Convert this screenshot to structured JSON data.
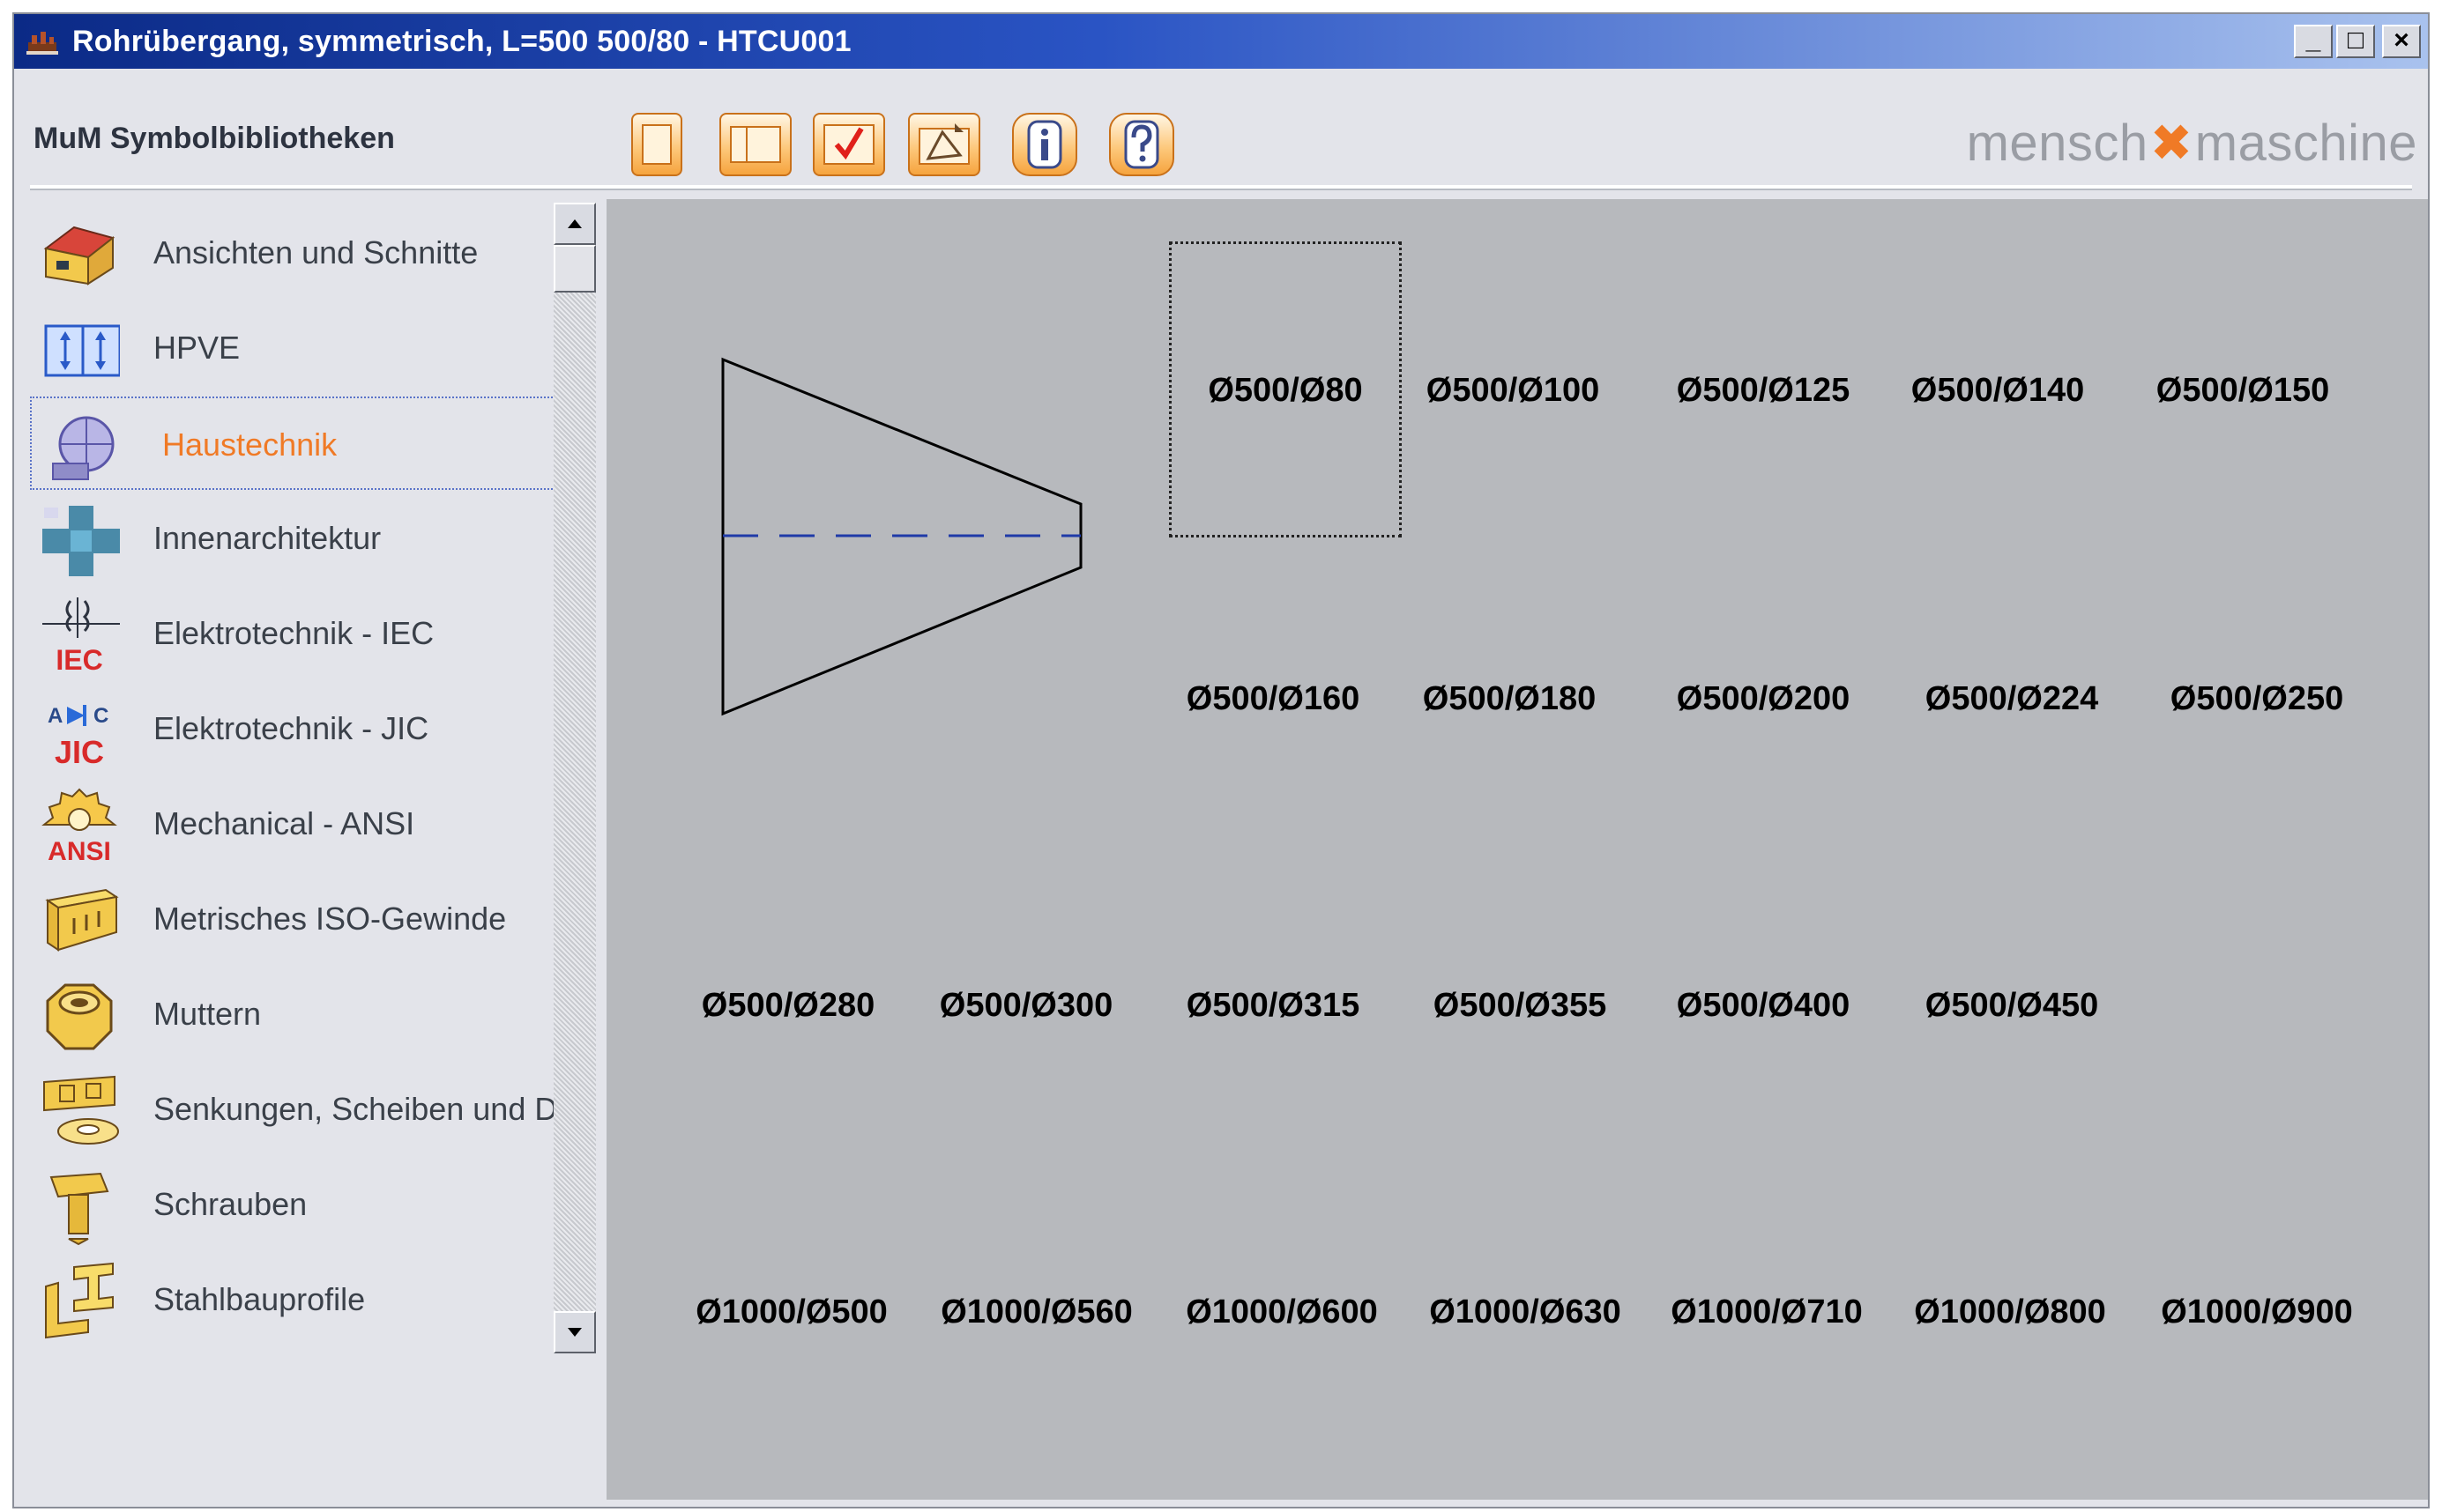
{
  "window": {
    "title": "Rohrübergang, symmetrisch, L=500 500/80 - HTCU001",
    "controls": {
      "minimize": "_",
      "maximize": "□",
      "close": "×"
    }
  },
  "toolbar": {
    "library_title": "MuM Symbolbibliotheken",
    "brand_left": "mensch",
    "brand_right": "maschine"
  },
  "sidebar": {
    "items": [
      {
        "label": "Ansichten und Schnitte",
        "icon": "house-icon"
      },
      {
        "label": "HPVE",
        "icon": "arrows-icon"
      },
      {
        "label": "Haustechnik",
        "icon": "pump-icon",
        "selected": true
      },
      {
        "label": "Innenarchitektur",
        "icon": "furniture-icon"
      },
      {
        "label": "Elektrotechnik - IEC",
        "icon": "iec-icon",
        "badge": "IEC"
      },
      {
        "label": "Elektrotechnik - JIC",
        "icon": "jic-icon",
        "badge": "JIC"
      },
      {
        "label": "Mechanical - ANSI",
        "icon": "gear-icon",
        "badge": "ANSI"
      },
      {
        "label": "Metrisches ISO-Gewinde",
        "icon": "thread-icon"
      },
      {
        "label": "Muttern",
        "icon": "nut-icon"
      },
      {
        "label": "Senkungen, Scheiben und Du",
        "icon": "washer-icon"
      },
      {
        "label": "Schrauben",
        "icon": "screw-icon"
      },
      {
        "label": "Stahlbauprofile",
        "icon": "steel-profile-icon"
      }
    ]
  },
  "sizes": {
    "row1": [
      "Ø500/Ø80",
      "Ø500/Ø100",
      "Ø500/Ø125",
      "Ø500/Ø140",
      "Ø500/Ø150"
    ],
    "row2": [
      "Ø500/Ø160",
      "Ø500/Ø180",
      "Ø500/Ø200",
      "Ø500/Ø224",
      "Ø500/Ø250"
    ],
    "row3": [
      "Ø500/Ø280",
      "Ø500/Ø300",
      "Ø500/Ø315",
      "Ø500/Ø355",
      "Ø500/Ø400",
      "Ø500/Ø450"
    ],
    "row4": [
      "Ø1000/Ø500",
      "Ø1000/Ø560",
      "Ø1000/Ø600",
      "Ø1000/Ø630",
      "Ø1000/Ø710",
      "Ø1000/Ø800",
      "Ø1000/Ø900"
    ],
    "selected": "Ø500/Ø80"
  },
  "colors": {
    "title_bar": "#0b2a86",
    "accent": "#f07a26",
    "canvas": "#b7b9bd"
  }
}
